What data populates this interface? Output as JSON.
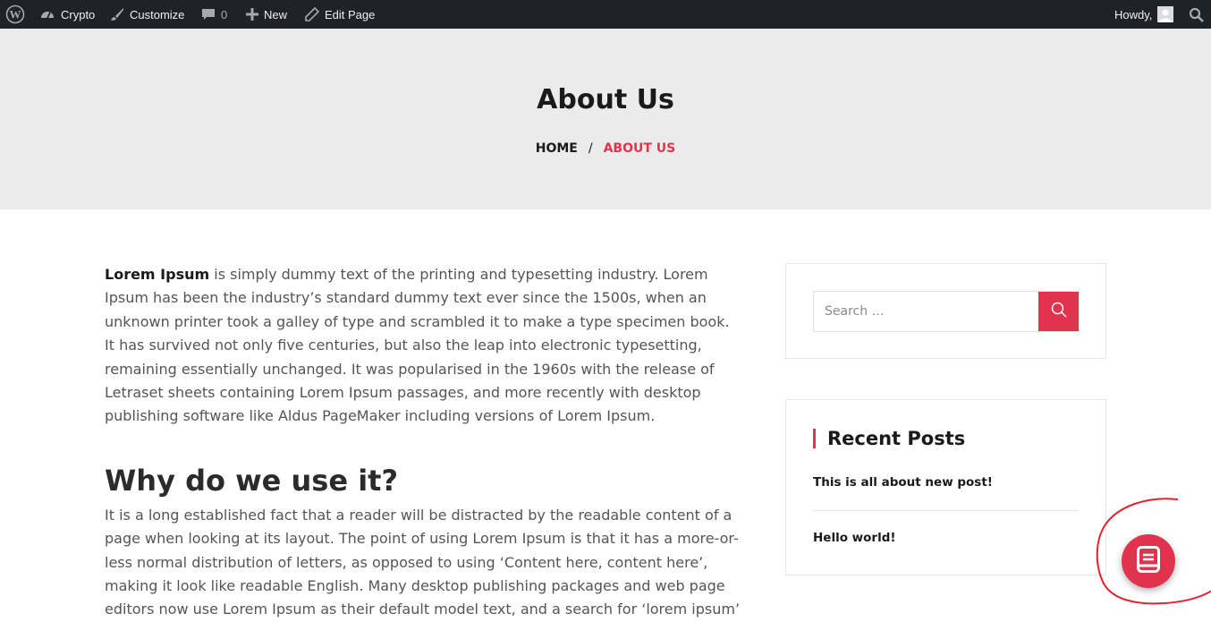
{
  "adminbar": {
    "site_name": "Crypto",
    "customize": "Customize",
    "comments_count": "0",
    "new": "New",
    "edit_page": "Edit Page",
    "howdy": "Howdy,"
  },
  "page": {
    "title": "About Us"
  },
  "breadcrumb": {
    "home": "HOME",
    "separator": "/",
    "current": "ABOUT US"
  },
  "content": {
    "intro_bold": "Lorem Ipsum",
    "intro_rest": " is simply dummy text of the printing and typesetting industry. Lorem Ipsum has been the industry’s standard dummy text ever since the 1500s, when an unknown printer took a galley of type and scrambled it to make a type specimen book. It has survived not only five centuries, but also the leap into electronic typesetting, remaining essentially unchanged. It was popularised in the 1960s with the release of Letraset sheets containing Lorem Ipsum passages, and more recently with desktop publishing software like Aldus PageMaker including versions of Lorem Ipsum.",
    "heading": "Why do we use it?",
    "paragraph2": "It is a long established fact that a reader will be distracted by the readable content of a page when looking at its layout. The point of using Lorem Ipsum is that it has a more-or-less normal distribution of letters, as opposed to using ‘Content here, content here’, making it look like readable English. Many desktop publishing packages and web page editors now use Lorem Ipsum as their default model text, and a search for ‘lorem ipsum’"
  },
  "sidebar": {
    "search_placeholder": "Search …",
    "recent_title": "Recent Posts",
    "recent_posts": [
      "This is all about new post!",
      "Hello world!"
    ]
  },
  "colors": {
    "accent": "#e0344e",
    "adminbar_bg": "#1d2327",
    "banner_bg": "#ebebeb"
  },
  "icons": {
    "wordpress": "wordpress-logo-icon",
    "site": "dashboard-icon",
    "customize": "brush-icon",
    "comments": "comment-icon",
    "new": "plus-icon",
    "edit": "pencil-icon",
    "avatar": "avatar-icon",
    "adminbar_search": "search-icon",
    "search_button": "search-icon",
    "fab": "document-icon"
  }
}
